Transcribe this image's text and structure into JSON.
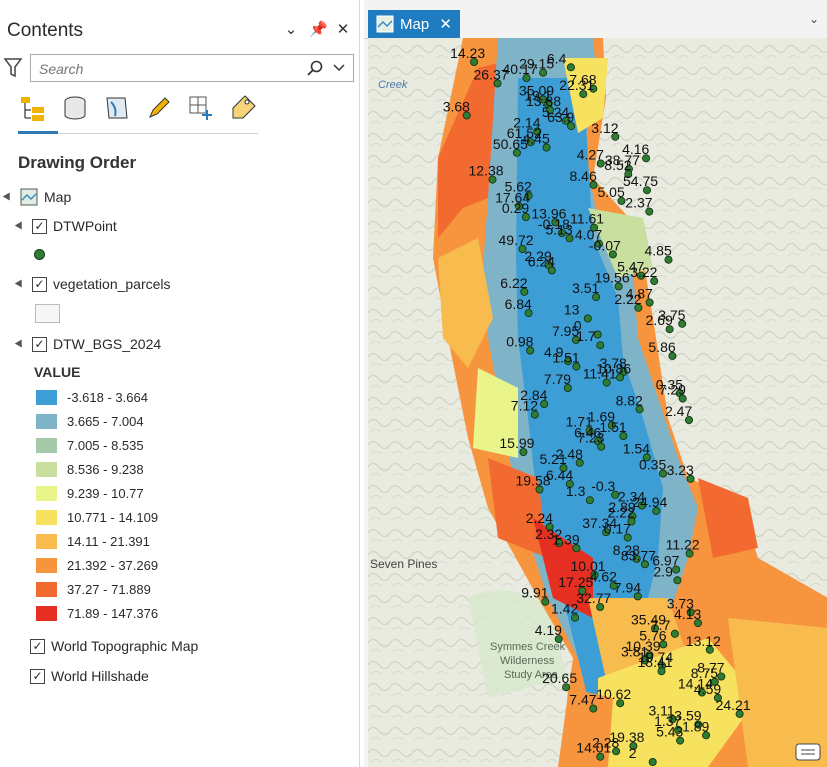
{
  "contents": {
    "title": "Contents",
    "search_placeholder": "Search",
    "section": "Drawing Order",
    "map_label": "Map",
    "layers": [
      {
        "name": "DTWPoint",
        "checked": true
      },
      {
        "name": "vegetation_parcels",
        "checked": true
      },
      {
        "name": "DTW_BGS_2024",
        "checked": true
      },
      {
        "name": "World Topographic Map",
        "checked": true
      },
      {
        "name": "World Hillshade",
        "checked": true
      }
    ],
    "value_label": "VALUE",
    "legend": [
      {
        "label": "-3.618 - 3.664",
        "color": "#3d9ed6"
      },
      {
        "label": "3.665 - 7.004",
        "color": "#7fb3c8"
      },
      {
        "label": "7.005 - 8.535",
        "color": "#a6c9aa"
      },
      {
        "label": "8.536 - 9.238",
        "color": "#c9dfa0"
      },
      {
        "label": "9.239 - 10.77",
        "color": "#e9f58a"
      },
      {
        "label": "10.771 - 14.109",
        "color": "#f7e260"
      },
      {
        "label": "14.11 - 21.391",
        "color": "#f7bb4e"
      },
      {
        "label": "21.392 - 37.269",
        "color": "#f7953f"
      },
      {
        "label": "37.27 - 71.889",
        "color": "#f26a30"
      },
      {
        "label": "71.89 - 147.376",
        "color": "#e52f22"
      }
    ]
  },
  "map": {
    "tab_label": "Map",
    "base_labels": [
      "Creek",
      "Seven Pines",
      "Symmes Creek",
      "Wilderness",
      "Study Area"
    ],
    "values": [
      "14.23",
      "6.4",
      "29.15",
      "40.17",
      "26.37",
      "7.68",
      "22.31",
      "35.09",
      "19.1",
      "13.88",
      "3.68",
      "5.24",
      "63.9",
      "2.14",
      "3.12",
      "61.52",
      "4.45",
      "50.65",
      "4.16",
      "4.27",
      "38.77",
      "8.52",
      "12.38",
      "8.46",
      "54.75",
      "5.62",
      "5.05",
      "17.64",
      "2.37",
      "0.29",
      "13.96",
      "11.61",
      "-0.18",
      "5.13",
      "4.07",
      "49.72",
      "-0.07",
      "4.85",
      "2.29",
      "6.24",
      "5.47",
      "3.22",
      "19.56",
      "6.22",
      "3.51",
      "4.87",
      "2.22",
      "6.84",
      "13",
      "3.75",
      "2.69",
      "0",
      "7.95",
      "1.7",
      "0.98",
      "5.86",
      "4.9",
      "1.51",
      "3.78",
      "10.86",
      "11.41",
      "7.79",
      "0.35",
      "7.29",
      "2.84",
      "8.82",
      "7.12",
      "2.47",
      "1.69",
      "1.71",
      "1.51",
      "6.46",
      "7.23",
      "15.99",
      "1.54",
      "2.48",
      "5.21",
      "0.35",
      "3.23",
      "6.44",
      "19.58",
      "-0.3",
      "1.3",
      "2.34",
      "24.94",
      "2.89",
      "2.22",
      "2.24",
      "37.34",
      "0.17",
      "2.32",
      "1.39",
      "11.22",
      "8.28",
      "83.77",
      "6.97",
      "10.01",
      "2.9",
      "4.62",
      "17.25",
      "7.94",
      "9.91",
      "32.77",
      "3.73",
      "1.42",
      "4.13",
      "35.49",
      "7.7",
      "4.19",
      "5.76",
      "13.12",
      "10.39",
      "3.81",
      "19.74",
      "18.41",
      "8.77",
      "8.75",
      "20.65",
      "14.14",
      "4.59",
      "10.62",
      "7.47",
      "24.21",
      "3.11",
      "3.59",
      "1.37",
      "1.89",
      "5.43",
      "19.38",
      "2.28",
      "14.01",
      "2"
    ]
  }
}
